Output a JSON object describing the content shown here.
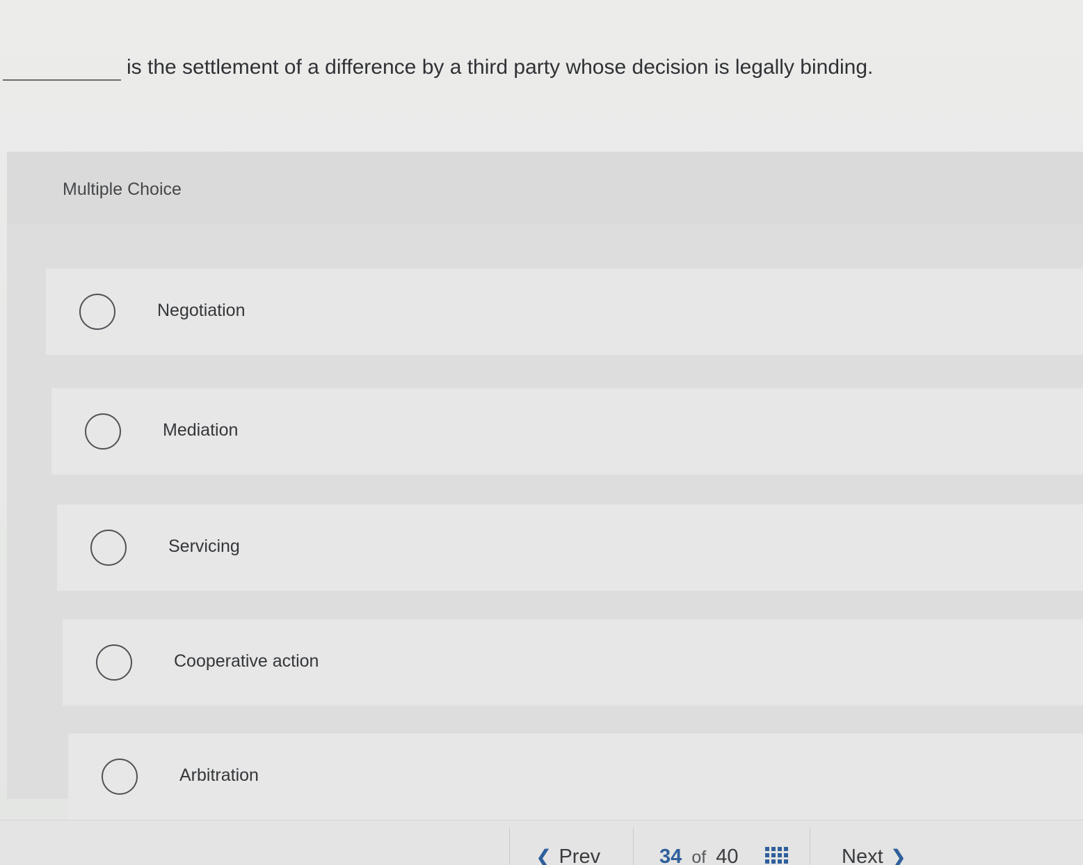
{
  "question": {
    "text": "is the settlement of a difference by a third party whose decision is legally binding."
  },
  "multiple_choice": {
    "label": "Multiple Choice",
    "options": [
      {
        "label": "Negotiation"
      },
      {
        "label": "Mediation"
      },
      {
        "label": "Servicing"
      },
      {
        "label": "Cooperative action"
      },
      {
        "label": "Arbitration"
      }
    ]
  },
  "navigation": {
    "prev_label": "Prev",
    "next_label": "Next",
    "current": "34",
    "of_label": "of",
    "total": "40",
    "prev_icon": "chevron-left-icon",
    "next_icon": "chevron-right-icon",
    "grid_icon": "grid-icon"
  },
  "colors": {
    "accent": "#2f5f9c"
  }
}
